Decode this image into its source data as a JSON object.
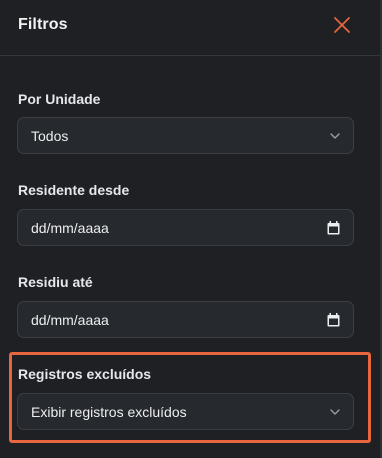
{
  "header": {
    "title": "Filtros",
    "close_icon": "close-icon"
  },
  "filters": {
    "unidade": {
      "label": "Por Unidade",
      "selected": "Todos"
    },
    "residente_desde": {
      "label": "Residente desde",
      "placeholder": "dd/mm/aaaa"
    },
    "residiu_ate": {
      "label": "Residiu até",
      "placeholder": "dd/mm/aaaa"
    },
    "registros_excluidos": {
      "label": "Registros excluídos",
      "selected": "Exibir registros excluídos"
    }
  },
  "colors": {
    "background": "#1e2023",
    "input_background": "#26292d",
    "border": "#3b3f45",
    "accent": "#e8663d",
    "text": "#e8e9ec"
  },
  "icons": {
    "close": "close-icon",
    "chevron": "chevron-down-icon",
    "calendar": "calendar-icon"
  }
}
